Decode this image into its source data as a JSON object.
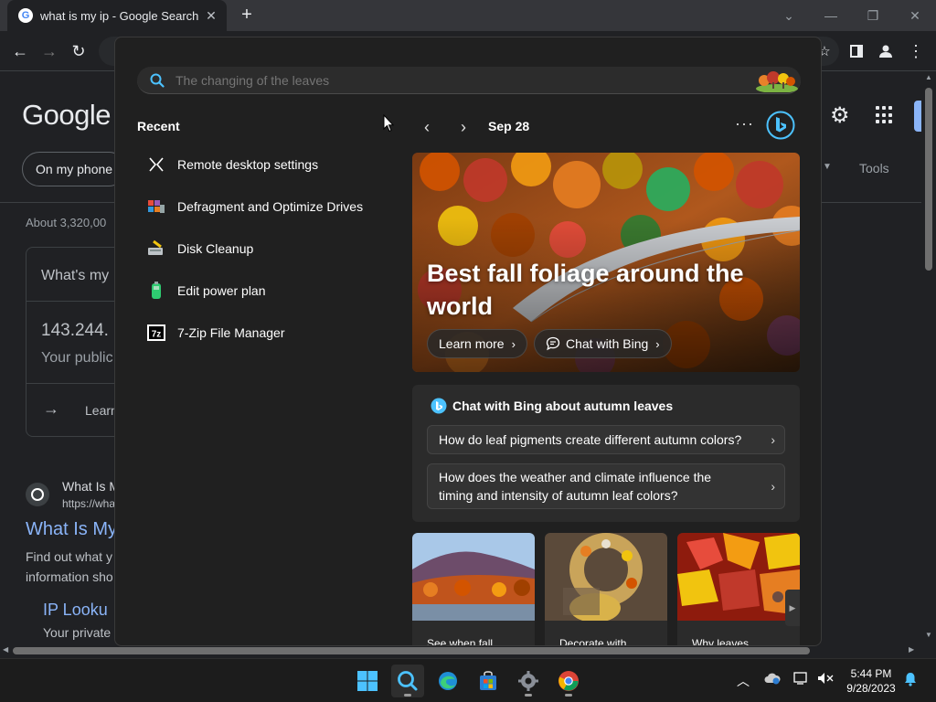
{
  "browser": {
    "tab_title": "what is my ip - Google Search",
    "tab_favicon": "G",
    "new_tab_label": "+"
  },
  "google_page": {
    "logo": "Google",
    "filter_chip": "On my phone",
    "tools": "Tools",
    "results_count": "About 3,320,00",
    "card": {
      "question": "What's my",
      "ip": "143.244.",
      "caption": "Your public",
      "learn": "Learn"
    },
    "result1": {
      "site": "What Is M",
      "url": "https://wha",
      "title": "What Is My",
      "snippet_line1": "Find out what y",
      "snippet_line2": "information sho"
    },
    "result2": {
      "title": "IP Looku",
      "snippet": "Your private"
    }
  },
  "search_flyout": {
    "query_placeholder": "The changing of the leaves",
    "recent_title": "Recent",
    "recent_items": [
      {
        "label": "Remote desktop settings",
        "icon": "remote-desktop-icon"
      },
      {
        "label": "Defragment and Optimize Drives",
        "icon": "defragment-icon"
      },
      {
        "label": "Disk Cleanup",
        "icon": "disk-cleanup-icon"
      },
      {
        "label": "Edit power plan",
        "icon": "power-plan-icon"
      },
      {
        "label": "7-Zip File Manager",
        "icon": "7zip-icon"
      }
    ],
    "date": "Sep 28",
    "more": "···",
    "hero": {
      "title": "Best fall foliage around the world",
      "learn_more": "Learn more",
      "chat_with_bing": "Chat with Bing"
    },
    "chat_card": {
      "heading": "Chat with Bing about autumn leaves",
      "questions": [
        "How do leaf pigments create different autumn colors?",
        "How does the weather and climate influence the timing and intensity of autumn leaf colors?"
      ]
    },
    "tiles": [
      {
        "caption": "See when fall"
      },
      {
        "caption": "Decorate with"
      },
      {
        "caption": "Why leaves"
      }
    ]
  },
  "taskbar": {
    "time": "5:44 PM",
    "date": "9/28/2023"
  },
  "colors": {
    "accent": "#4cc2ff",
    "link": "#8ab4f8",
    "flyout_bg": "#202020"
  }
}
